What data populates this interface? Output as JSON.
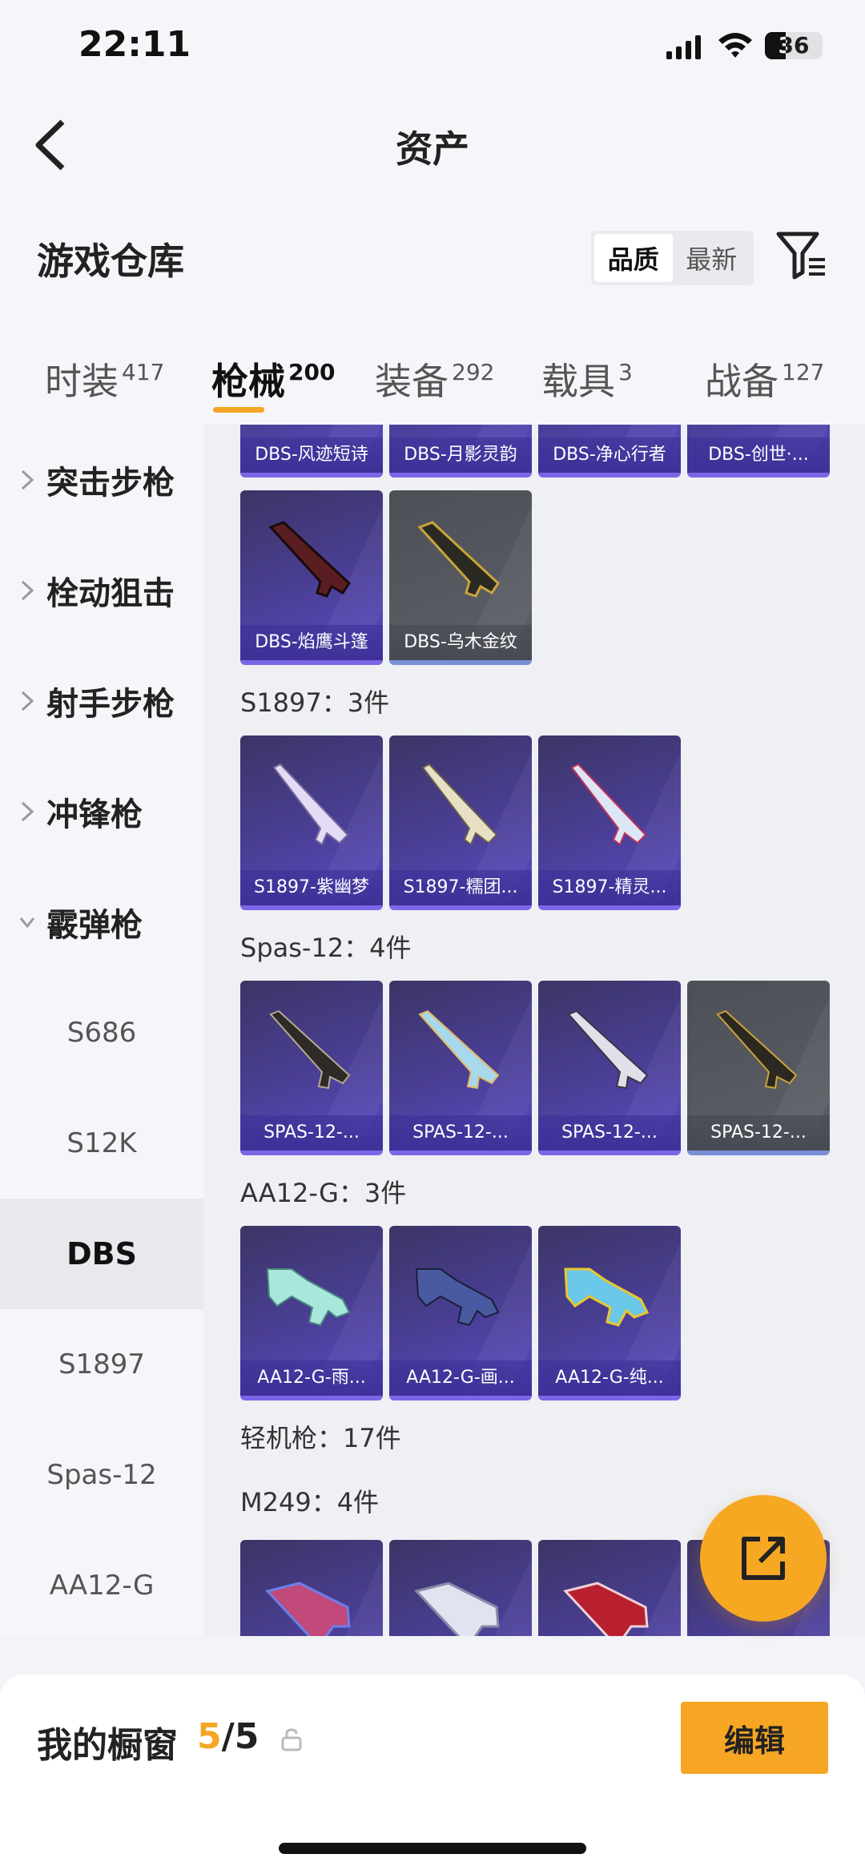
{
  "status_bar": {
    "time": "22:11",
    "battery": "36"
  },
  "nav": {
    "title": "资产"
  },
  "section": {
    "heading": "游戏仓库",
    "sort_options": [
      "品质",
      "最新"
    ],
    "sort_selected": "品质"
  },
  "tabs": [
    {
      "label": "时装",
      "count": "417"
    },
    {
      "label": "枪械",
      "count": "200"
    },
    {
      "label": "装备",
      "count": "292"
    },
    {
      "label": "载具",
      "count": "3"
    },
    {
      "label": "战备",
      "count": "127"
    }
  ],
  "sidebar": {
    "categories": [
      "突击步枪",
      "栓动狙击",
      "射手步枪",
      "冲锋枪",
      "霰弹枪"
    ],
    "subitems": [
      "S686",
      "S12K",
      "DBS",
      "S1897",
      "Spas-12",
      "AA12-G"
    ],
    "selected": "DBS"
  },
  "content": {
    "dbs_top_row": [
      "DBS-风迹短诗",
      "DBS-月影灵韵",
      "DBS-净心行者",
      "DBS-创世·..."
    ],
    "dbs_second_row": [
      "DBS-焰鹰斗篷",
      "DBS-乌木金纹"
    ],
    "s1897": {
      "header": "S1897：3件",
      "items": [
        "S1897-紫幽梦",
        "S1897-糯团...",
        "S1897-精灵..."
      ]
    },
    "spas12": {
      "header": "Spas-12：4件",
      "items": [
        "SPAS-12-...",
        "SPAS-12-...",
        "SPAS-12-...",
        "SPAS-12-..."
      ]
    },
    "aa12g": {
      "header": "AA12-G：3件",
      "items": [
        "AA12-G-雨...",
        "AA12-G-画...",
        "AA12-G-纯..."
      ]
    },
    "lmg_header": "轻机枪：17件",
    "m249_header": "M249：4件"
  },
  "bottom": {
    "title": "我的橱窗",
    "count_current": "5",
    "count_total": "/5",
    "edit_label": "编辑"
  },
  "colors": {
    "accent": "#f5a623",
    "card_purple": "#4a3f96",
    "card_gray": "#5e6068"
  }
}
